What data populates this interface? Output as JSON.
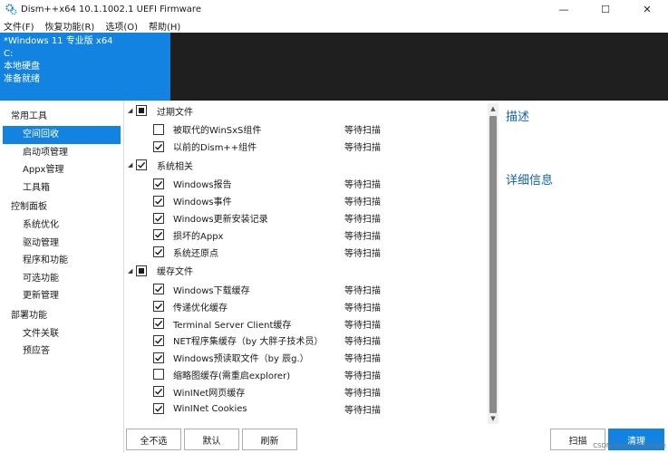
{
  "window": {
    "title": "Dism++x64 10.1.1002.1 UEFI Firmware",
    "controls": [
      "—",
      "☐",
      "✕"
    ]
  },
  "menu": [
    "文件(F)",
    "恢复功能(R)",
    "选项(O)",
    "帮助(H)"
  ],
  "system": {
    "name": "*Windows 11 专业版 x64",
    "drive": "C:",
    "disk": "本地硬盘",
    "status": "准备就绪"
  },
  "sidebar": {
    "groups": [
      {
        "label": "常用工具",
        "items": [
          "空间回收",
          "启动项管理",
          "Appx管理",
          "工具箱"
        ]
      },
      {
        "label": "控制面板",
        "items": [
          "系统优化",
          "驱动管理",
          "程序和功能",
          "可选功能",
          "更新管理"
        ]
      },
      {
        "label": "部署功能",
        "items": [
          "文件关联",
          "预应答"
        ]
      }
    ],
    "selected": "空间回收"
  },
  "tree": [
    {
      "label": "过期文件",
      "state": "partial",
      "items": [
        {
          "label": "被取代的WinSxS组件",
          "checked": false,
          "status": "等待扫描"
        },
        {
          "label": "以前的Dism++组件",
          "checked": true,
          "status": "等待扫描"
        }
      ]
    },
    {
      "label": "系统相关",
      "state": "checked",
      "items": [
        {
          "label": "Windows报告",
          "checked": true,
          "status": "等待扫描"
        },
        {
          "label": "Windows事件",
          "checked": true,
          "status": "等待扫描"
        },
        {
          "label": "Windows更新安装记录",
          "checked": true,
          "status": "等待扫描"
        },
        {
          "label": "损坏的Appx",
          "checked": true,
          "status": "等待扫描"
        },
        {
          "label": "系统还原点",
          "checked": true,
          "status": "等待扫描"
        }
      ]
    },
    {
      "label": "缓存文件",
      "state": "partial",
      "items": [
        {
          "label": "Windows下载缓存",
          "checked": true,
          "status": "等待扫描"
        },
        {
          "label": "传递优化缓存",
          "checked": true,
          "status": "等待扫描"
        },
        {
          "label": "Terminal Server Client缓存",
          "checked": true,
          "status": "等待扫描"
        },
        {
          "label": "NET程序集缓存（by 大胖子技术员）",
          "checked": true,
          "status": "等待扫描"
        },
        {
          "label": "Windows预读取文件（by 辰g.）",
          "checked": true,
          "status": "等待扫描"
        },
        {
          "label": "缩略图缓存(需重启explorer)",
          "checked": false,
          "status": "等待扫描"
        },
        {
          "label": "WinINet网页缓存",
          "checked": true,
          "status": "等待扫描"
        },
        {
          "label": "WinINet Cookies",
          "checked": true,
          "status": "等待扫描"
        }
      ]
    }
  ],
  "right_panel": {
    "description_title": "描述",
    "details_title": "详细信息"
  },
  "buttons": {
    "deselect_all": "全不选",
    "default": "默认",
    "refresh": "刷新",
    "scan": "扫描",
    "clean": "清理"
  },
  "watermark": "CSDN @namelessmyth",
  "colors": {
    "accent": "#1283e0",
    "header_bg": "#1f1f1f",
    "heading_text": "#1360b0"
  }
}
